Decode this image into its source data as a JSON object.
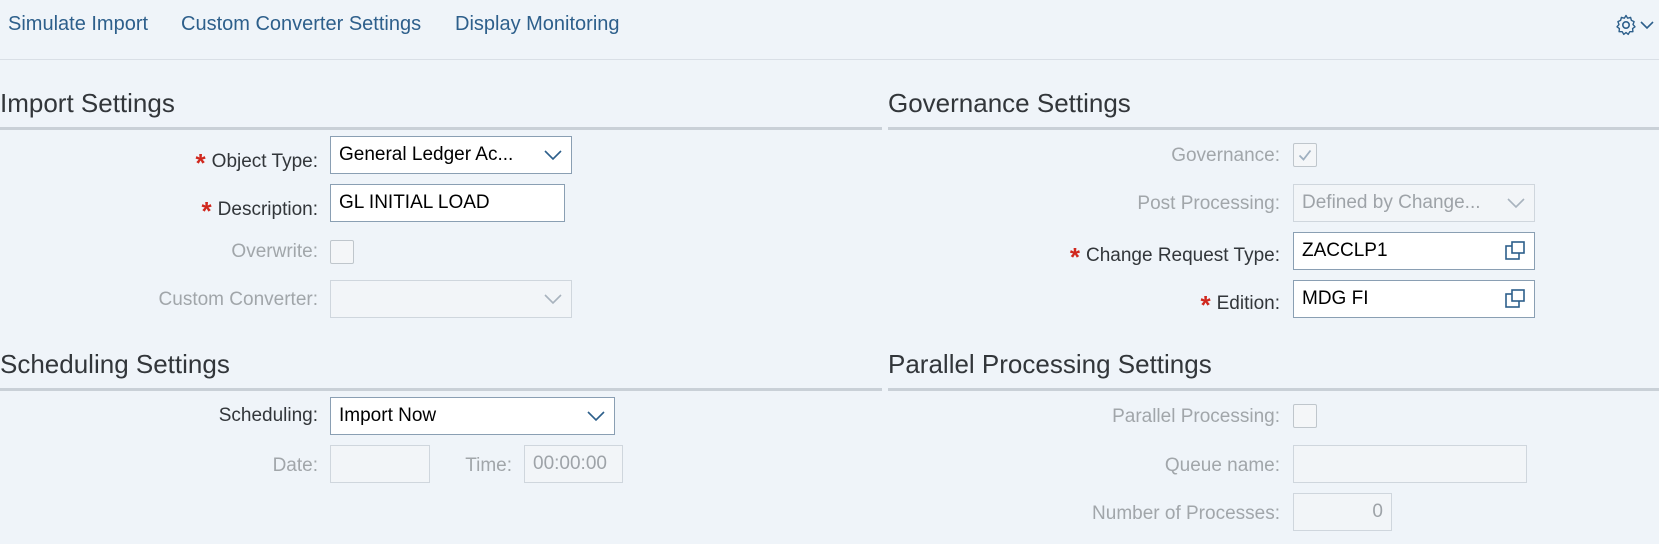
{
  "toolbar": {
    "links": [
      "Simulate Import",
      "Custom Converter Settings",
      "Display Monitoring"
    ],
    "settings_icon": "gear-icon"
  },
  "import_settings": {
    "title": "Import Settings",
    "object_type_label": "Object Type:",
    "object_type_value": "General Ledger Ac...",
    "description_label": "Description:",
    "description_value": "GL INITIAL LOAD",
    "overwrite_label": "Overwrite:",
    "overwrite_checked": false,
    "custom_converter_label": "Custom Converter:",
    "custom_converter_value": ""
  },
  "governance_settings": {
    "title": "Governance Settings",
    "governance_label": "Governance:",
    "governance_checked": true,
    "post_processing_label": "Post Processing:",
    "post_processing_value": "Defined by Change...",
    "change_request_type_label": "Change Request Type:",
    "change_request_type_value": "ZACCLP1",
    "edition_label": "Edition:",
    "edition_value": "MDG FI"
  },
  "scheduling_settings": {
    "title": "Scheduling Settings",
    "scheduling_label": "Scheduling:",
    "scheduling_value": "Import Now",
    "date_label": "Date:",
    "date_value": "",
    "time_label": "Time:",
    "time_value": "00:00:00"
  },
  "parallel_processing_settings": {
    "title": "Parallel Processing Settings",
    "parallel_processing_label": "Parallel Processing:",
    "parallel_processing_checked": false,
    "queue_name_label": "Queue name:",
    "queue_name_value": "",
    "number_of_processes_label": "Number of Processes:",
    "number_of_processes_value": "0"
  },
  "colors": {
    "background": "#eff4f9",
    "link": "#2d5f8b",
    "required": "#d0271d",
    "field_border": "#8a9fb3",
    "disabled_text": "#a1a6aa"
  }
}
